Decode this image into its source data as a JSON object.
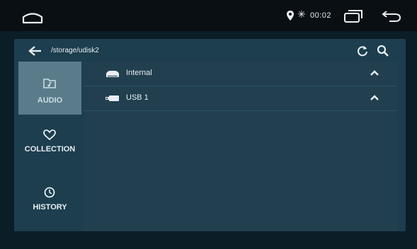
{
  "statusbar": {
    "time": "00:02",
    "bluetooth_symbol": "✳",
    "icons": [
      "home-icon",
      "location-icon",
      "bluetooth-icon",
      "recent-apps-icon",
      "back-icon"
    ]
  },
  "pathbar": {
    "path": "/storage/udisk2",
    "icons": [
      "back-arrow-icon",
      "refresh-icon",
      "search-icon"
    ]
  },
  "sidebar": {
    "items": [
      {
        "label": "AUDIO",
        "icon": "folder-music-icon",
        "active": true
      },
      {
        "label": "COLLECTION",
        "icon": "heart-icon",
        "active": false
      },
      {
        "label": "HISTORY",
        "icon": "clock-icon",
        "active": false
      }
    ]
  },
  "storage": {
    "items": [
      {
        "name": "Internal",
        "icon": "drive-icon",
        "expanded_indicator": "chevron-up-icon"
      },
      {
        "name": "USB 1",
        "icon": "usb-icon",
        "expanded_indicator": "chevron-up-icon"
      }
    ]
  },
  "colors": {
    "background": "#0b1d27",
    "panel": "#1c3e4e",
    "active_tab": "#5a7c8a",
    "text": "#e8eef2"
  }
}
